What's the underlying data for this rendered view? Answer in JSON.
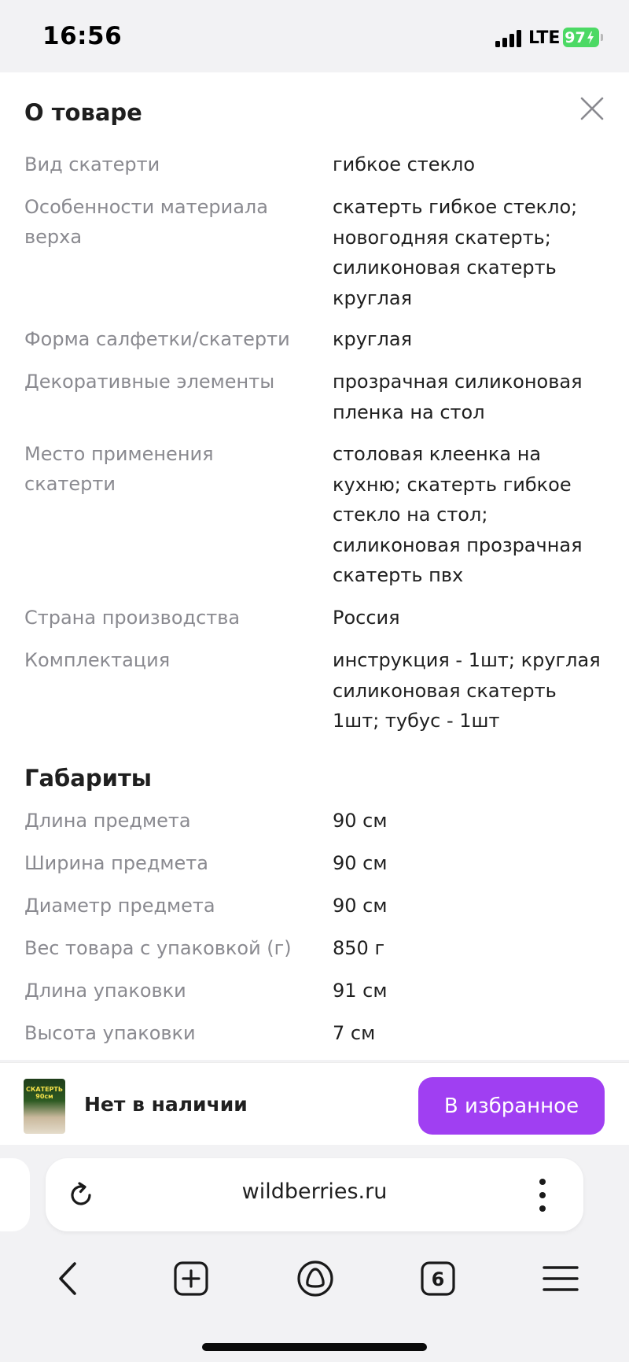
{
  "status_bar": {
    "time": "16:56",
    "network": "LTE",
    "battery": "97"
  },
  "sheet": {
    "title": "О товаре",
    "specs": [
      {
        "label": "Вид скатерти",
        "value": "гибкое стекло"
      },
      {
        "label": "Особенности материала верха",
        "value": "скатерть гибкое стекло; новогодняя скатерть; силиконовая скатерть круглая"
      },
      {
        "label": "Форма салфетки/скатерти",
        "value": "круглая"
      },
      {
        "label": "Декоративные элементы",
        "value": "прозрачная силиконовая пленка на стол"
      },
      {
        "label": "Место применения скатерти",
        "value": "столовая клеенка на кухню; скатерть гибкое стекло на стол; силиконовая прозрачная скатерть пвх"
      },
      {
        "label": "Страна производства",
        "value": "Россия"
      },
      {
        "label": "Комплектация",
        "value": "инструкция - 1шт; круглая силиконовая скатерть 1шт; тубус - 1шт"
      }
    ],
    "dimensions_title": "Габариты",
    "dimensions": [
      {
        "label": "Длина предмета",
        "value": "90 см"
      },
      {
        "label": "Ширина предмета",
        "value": "90 см"
      },
      {
        "label": "Диаметр предмета",
        "value": "90 см"
      },
      {
        "label": "Вес товара с упаковкой (г)",
        "value": "850 г"
      },
      {
        "label": "Длина упаковки",
        "value": "91 см"
      },
      {
        "label": "Высота упаковки",
        "value": "7 см"
      }
    ]
  },
  "product_bar": {
    "thumbnail_text": "СКАТЕРТЬ 90см",
    "stock_status": "Нет в наличии",
    "favorite_button": "В избранное"
  },
  "browser": {
    "url": "wildberries.ru",
    "tab_count": "6"
  },
  "colors": {
    "accent": "#a03ff2",
    "label_gray": "#8a8a90",
    "battery_green": "#4cd964"
  }
}
